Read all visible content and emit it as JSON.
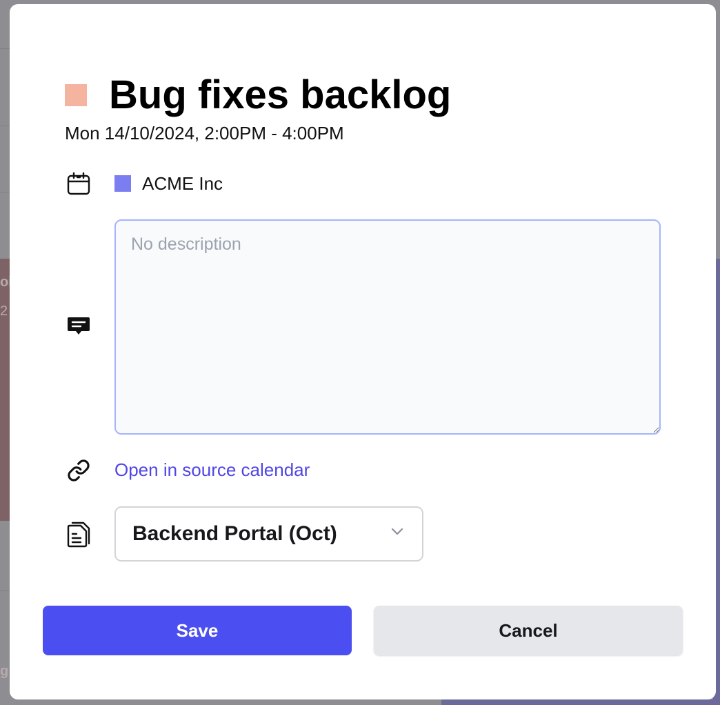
{
  "background": {
    "fragment_top": "oi",
    "fragment_mid": "2",
    "fragment_bottom": "g"
  },
  "event": {
    "title": "Bug fixes backlog",
    "time_range": "Mon 14/10/2024, 2:00PM - 4:00PM",
    "color": "#f5b4a0"
  },
  "calendar": {
    "icon": "calendar-icon",
    "name": "ACME Inc",
    "color": "#7b7ef0"
  },
  "description": {
    "icon": "comment-icon",
    "value": "",
    "placeholder": "No description"
  },
  "link": {
    "icon": "link-icon",
    "label": "Open in source calendar"
  },
  "project": {
    "icon": "document-icon",
    "selected": "Backend Portal (Oct)"
  },
  "actions": {
    "save_label": "Save",
    "cancel_label": "Cancel"
  },
  "colors": {
    "accent": "#4b4ef0",
    "link": "#4f46e5",
    "overlay": "#8e8e92"
  }
}
